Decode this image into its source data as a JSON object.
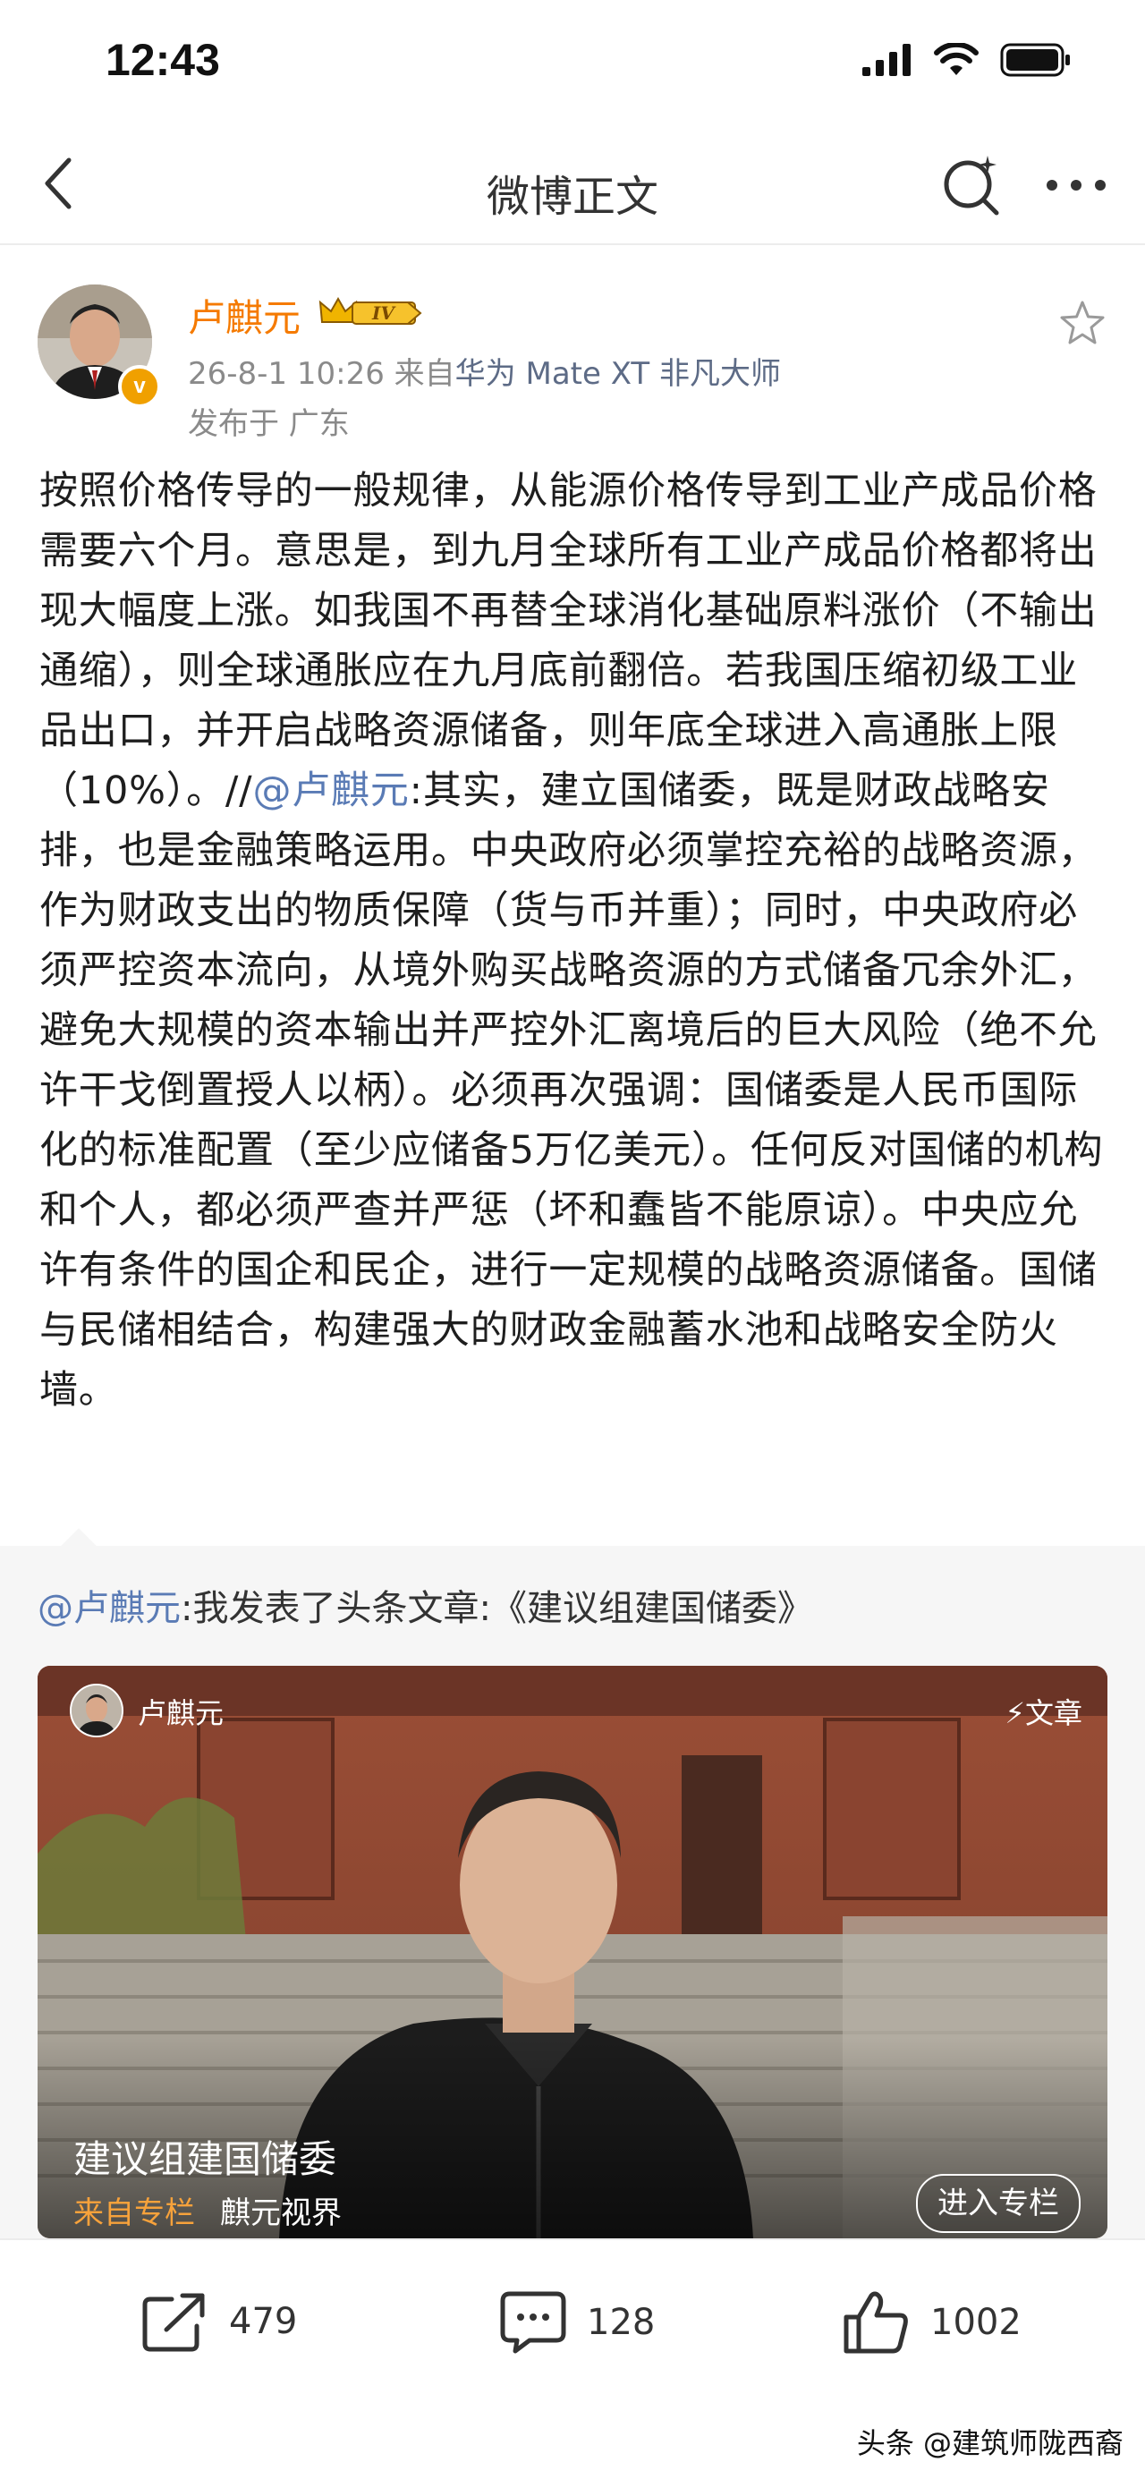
{
  "status_bar": {
    "time": "12:43"
  },
  "nav": {
    "title": "微博正文"
  },
  "post": {
    "author": "卢麒元",
    "level_badge": "IV",
    "timestamp": "26-8-1 10:26",
    "source_prefix": "来自",
    "device": "华为 Mate XT 非凡大师",
    "location": "发布于 广东",
    "body_part1": "按照价格传导的一般规律，从能源价格传导到工业产成品价格需要六个月。意思是，到九月全球所有工业产成品价格都将出现大幅度上涨。如我国不再替全球消化基础原料涨价（不输出通缩），则全球通胀应在九月底前翻倍。若我国压缩初级工业品出口，并开启战略资源储备，则年底全球进入高通胀上限（10%）。//",
    "body_mention": "@卢麒元",
    "body_part2": ":其实，建立国储委，既是财政战略安排，也是金融策略运用。中央政府必须掌控充裕的战略资源，作为财政支出的物质保障（货与币并重）；同时，中央政府必须严控资本流向，从境外购买战略资源的方式储备冗余外汇，避免大规模的资本输出并严控外汇离境后的巨大风险（绝不允许干戈倒置授人以柄）。必须再次强调：国储委是人民币国际化的标准配置（至少应储备5万亿美元）。任何反对国储的机构和个人，都必须严查并严惩（坏和蠢皆不能原谅）。中央应允许有条件的国企和民企，进行一定规模的战略资源储备。国储与民储相结合，构建强大的财政金融蓄水池和战略安全防火墙。"
  },
  "repost": {
    "mention": "@卢麒元",
    "text": ":我发表了头条文章:《建议组建国储委》"
  },
  "article_card": {
    "author": "卢麒元",
    "type_label": "文章",
    "title": "建议组建国储委",
    "from_label": "来自专栏",
    "column_name": "麒元视界",
    "enter_button": "进入专栏"
  },
  "actions": {
    "share_count": "479",
    "comment_count": "128",
    "like_count": "1002"
  },
  "watermark": "头条 @建筑师陇西裔",
  "colors": {
    "accent_orange": "#f57a00",
    "link_blue": "#5a7bb5",
    "column_orange": "#f7a23b"
  }
}
